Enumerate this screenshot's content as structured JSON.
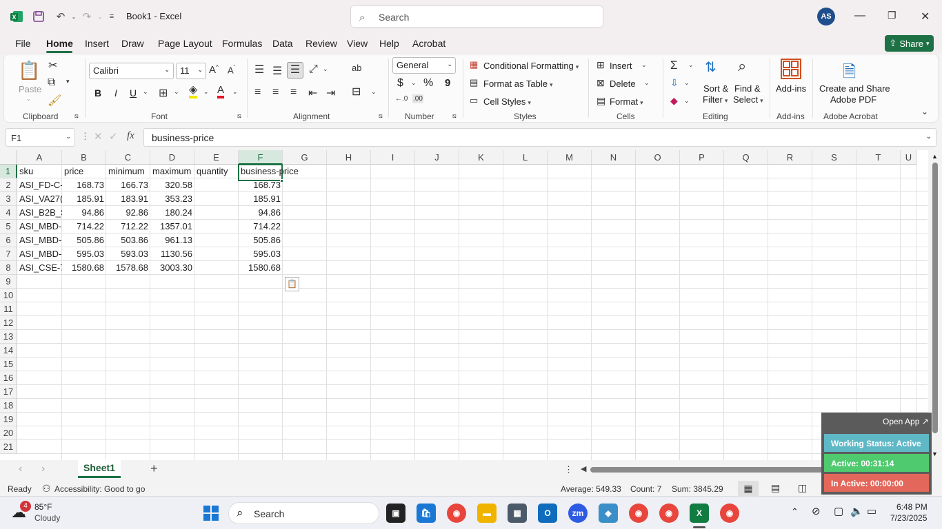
{
  "title_bar": {
    "doc_title": "Book1  -  Excel",
    "search_placeholder": "Search",
    "avatar_initials": "AS"
  },
  "menu": {
    "tabs": [
      "File",
      "Home",
      "Insert",
      "Draw",
      "Page Layout",
      "Formulas",
      "Data",
      "Review",
      "View",
      "Help",
      "Acrobat"
    ],
    "share_label": "Share"
  },
  "ribbon": {
    "clipboard": {
      "paste_label": "Paste",
      "group": "Clipboard"
    },
    "font": {
      "name": "Calibri",
      "size": "11",
      "group": "Font",
      "bold": "B",
      "italic": "I",
      "underline": "U"
    },
    "alignment": {
      "group": "Alignment"
    },
    "number": {
      "format": "General",
      "group": "Number",
      "currency": "$",
      "percent": "%",
      "comma": "9"
    },
    "styles": {
      "conditional": "Conditional Formatting",
      "format_table": "Format as Table",
      "cell_styles": "Cell Styles",
      "group": "Styles"
    },
    "cells": {
      "insert": "Insert",
      "delete": "Delete",
      "format": "Format",
      "group": "Cells"
    },
    "editing": {
      "sort_filter_1": "Sort &",
      "sort_filter_2": "Filter",
      "find_select_1": "Find &",
      "find_select_2": "Select",
      "group": "Editing"
    },
    "addins": {
      "label": "Add-ins",
      "group": "Add-ins"
    },
    "acrobat": {
      "label_1": "Create and Share",
      "label_2": "Adobe PDF",
      "group": "Adobe Acrobat"
    }
  },
  "formula_bar": {
    "name_box": "F1",
    "fx": "fx",
    "value": "business-price"
  },
  "grid": {
    "columns": [
      "A",
      "B",
      "C",
      "D",
      "E",
      "F",
      "G",
      "H",
      "I",
      "J",
      "K",
      "L",
      "M",
      "N",
      "O",
      "P",
      "Q",
      "R",
      "S",
      "T",
      "U"
    ],
    "rows": [
      "1",
      "2",
      "3",
      "4",
      "5",
      "6",
      "7",
      "8",
      "9",
      "10",
      "11",
      "12",
      "13",
      "14",
      "15",
      "16",
      "17",
      "18",
      "19",
      "20",
      "21"
    ],
    "headers": [
      "sku",
      "price",
      "minimum",
      "maximum",
      "quantity",
      "business-price"
    ],
    "data": [
      [
        "ASI_FD-C-",
        "168.73",
        "166.73",
        "320.58",
        "",
        "168.73"
      ],
      [
        "ASI_VA27(",
        "185.91",
        "183.91",
        "353.23",
        "",
        "185.91"
      ],
      [
        "ASI_B2B_S",
        "94.86",
        "92.86",
        "180.24",
        "",
        "94.86"
      ],
      [
        "ASI_MBD-",
        "714.22",
        "712.22",
        "1357.01",
        "",
        "714.22"
      ],
      [
        "ASI_MBD-",
        "505.86",
        "503.86",
        "961.13",
        "",
        "505.86"
      ],
      [
        "ASI_MBD-",
        "595.03",
        "593.03",
        "1130.56",
        "",
        "595.03"
      ],
      [
        "ASI_CSE-7",
        "1580.68",
        "1578.68",
        "3003.30",
        "",
        "1580.68"
      ]
    ],
    "selected_cell": "F1"
  },
  "sheets": {
    "active": "Sheet1"
  },
  "status": {
    "ready": "Ready",
    "accessibility": "Accessibility: Good to go",
    "average": "Average: 549.33",
    "count": "Count: 7",
    "sum": "Sum: 3845.29"
  },
  "widget": {
    "open_app": "Open App",
    "working": "Working Status: Active",
    "active": "Active: 00:31:14",
    "inactive": "In Active: 00:00:00"
  },
  "taskbar": {
    "weather_temp": "85°F",
    "weather_desc": "Cloudy",
    "weather_badge": "4",
    "search": "Search",
    "time": "6:48 PM",
    "date": "7/23/2025"
  },
  "colors": {
    "accent": "#1e7145",
    "widget_working": "#5fb8c6",
    "widget_active": "#4fca6e",
    "widget_inactive": "#e3675a"
  }
}
